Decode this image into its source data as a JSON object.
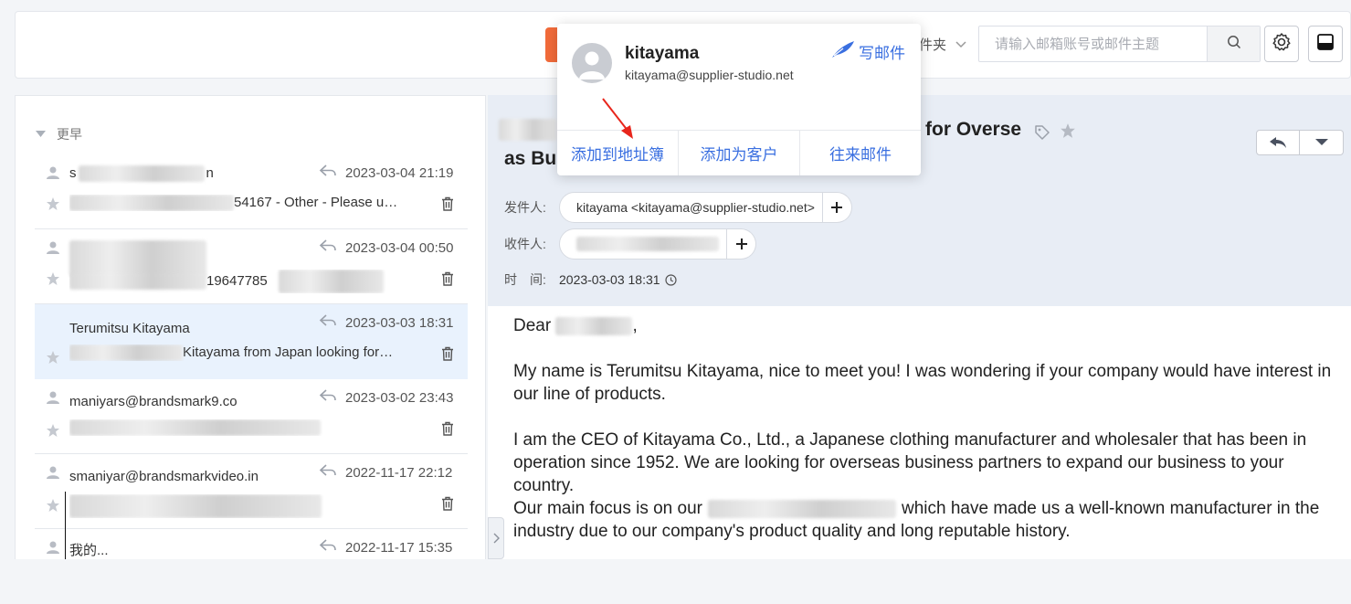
{
  "toolbar": {
    "folder_label": "件夹",
    "search_placeholder": "请输入邮箱账号或邮件主题"
  },
  "list": {
    "group_label": "更早",
    "items": [
      {
        "sender_tail": "n",
        "sender_prefix": "s",
        "time": "2023-03-04 21:19",
        "preview_tail": "54167 - Other - Please u…"
      },
      {
        "sender_tail": "",
        "sender_prefix": "",
        "time": "2023-03-04 00:50",
        "preview_tail": "19647785"
      },
      {
        "sender": "Terumitsu Kitayama",
        "time": "2023-03-03 18:31",
        "preview_tail": "Kitayama from Japan looking for…"
      },
      {
        "sender": "maniyars@brandsmark9.co",
        "time": "2023-03-02 23:43",
        "preview_tail": ""
      },
      {
        "sender": "smaniyar@brandsmarkvideo.in",
        "time": "2022-11-17 22:12",
        "preview_tail": ""
      },
      {
        "sender": "我的...",
        "time": "2022-11-17 15:35",
        "preview_tail": ""
      }
    ]
  },
  "email": {
    "subject_right": "for Overse",
    "subject_line2": "as Bus",
    "from_label": "发件人:",
    "from_value": "kitayama <kitayama@supplier-studio.net>",
    "to_label": "收件人:",
    "time_label": "时　间:",
    "time_value": "2023-03-03 18:31",
    "body": {
      "greeting": "Dear",
      "greeting_end": ",",
      "p1": "My name is Terumitsu Kitayama, nice to meet you! I was wondering if your company would have interest in our line of products.",
      "p2": "I am the CEO of Kitayama Co., Ltd., a Japanese clothing manufacturer and wholesaler that has been in operation since 1952. We are looking for overseas business partners to expand our business to your country.",
      "p3_start": "Our main focus is on our",
      "p3_end": "which have made us a well-known manufacturer in the industry due to our company's product quality and long reputable history."
    }
  },
  "popup": {
    "name": "kitayama",
    "email": "kitayama@supplier-studio.net",
    "write_label": "写邮件",
    "actions": [
      "添加到地址簿",
      "添加为客户",
      "往来邮件"
    ]
  },
  "colors": {
    "accent": "#3a6fe0",
    "annotation_arrow": "#e8261c",
    "orange_tab": "#f26b3a"
  }
}
